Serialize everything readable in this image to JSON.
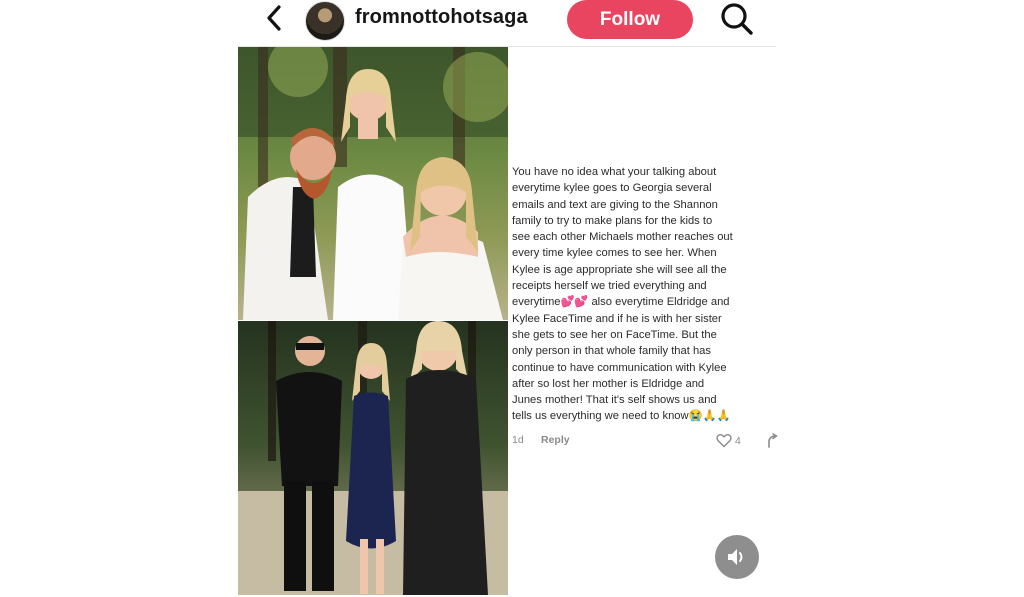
{
  "header": {
    "username": "fromnottohotsaga",
    "follow_label": "Follow"
  },
  "icons": {
    "back": "chevron-left-icon",
    "search": "search-icon",
    "sound": "speaker-icon",
    "like": "heart-icon",
    "share": "share-icon"
  },
  "colors": {
    "follow_bg": "#ea4560",
    "text": "#2b2b2b",
    "meta": "#8a8a8a"
  },
  "comment": {
    "text": "You have no idea what your talking about\neverytime kylee goes to Georgia several\nemails and text are giving to the Shannon\nfamily to try to make plans for the kids to\nsee each other Michaels mother reaches out\nevery time kylee comes to see her. When\nKylee is age appropriate she will see all the\nreceipts herself we tried everything and\neverytime💕💕 also everytime Eldridge and\nKylee FaceTime and if he is with her sister\nshe gets to see her on FaceTime. But the\nonly person in that whole family that has\ncontinue to have communication with Kylee\nafter so lost her mother is Eldridge and\nJunes mother! That it's self shows us and\ntells us everything we need to know😭🙏🙏",
    "time": "1d",
    "reply_label": "Reply",
    "like_count": "4"
  }
}
